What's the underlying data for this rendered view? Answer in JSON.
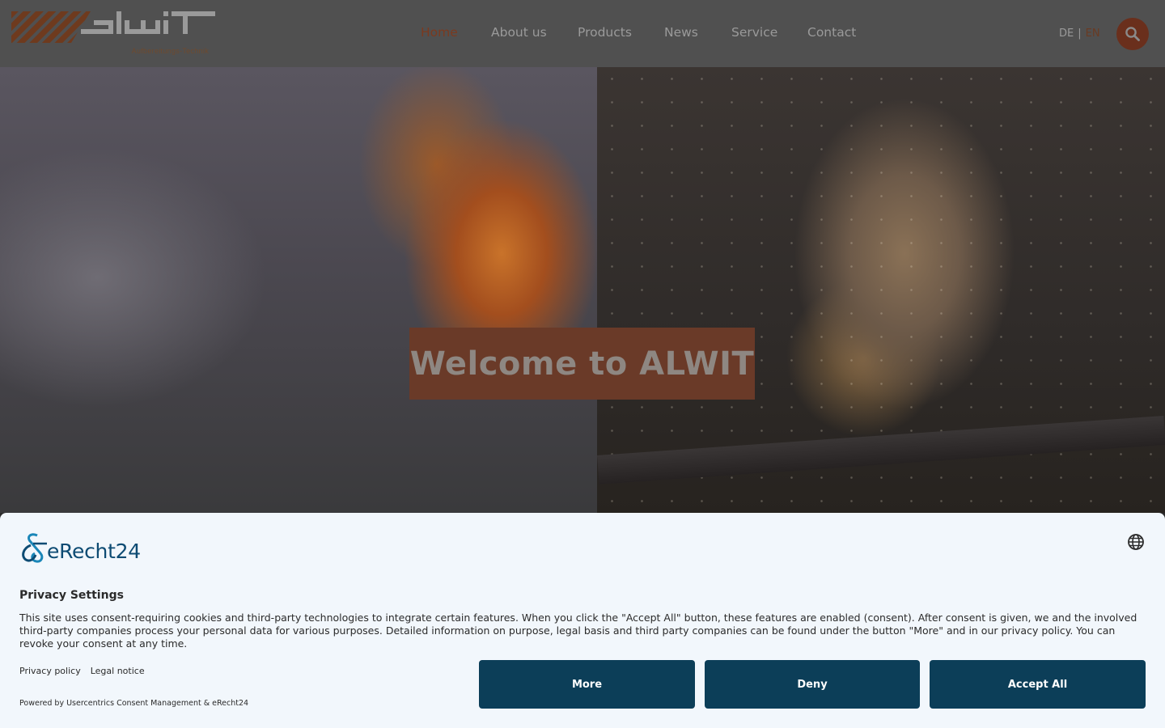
{
  "header": {
    "logo_text": "alwit",
    "tagline": "Aufbereitungs-Technik",
    "nav": [
      {
        "label": "Home",
        "active": true
      },
      {
        "label": "About us",
        "active": false
      },
      {
        "label": "Products",
        "active": false
      },
      {
        "label": "News",
        "active": false
      },
      {
        "label": "Service",
        "active": false
      },
      {
        "label": "Contact",
        "active": false
      }
    ],
    "languages": {
      "de": "DE",
      "separator": "|",
      "en": "EN",
      "active": "EN"
    },
    "search_icon": "search-icon"
  },
  "hero": {
    "title": "Welcome to ALWIT"
  },
  "consent": {
    "brand": "eRecht24",
    "globe_icon": "globe-icon",
    "title": "Privacy Settings",
    "text": "This site uses consent-requiring cookies and third-party technologies to integrate certain features. When you click the \"Accept All\" button, these features are enabled (consent). After consent is given, we and the involved third-party companies process your personal data for various purposes. Detailed information on purpose, legal basis and third party companies can be found under the button \"More\" and in our privacy policy. You can revoke your consent at any time.",
    "links": {
      "privacy": "Privacy policy",
      "legal": "Legal notice"
    },
    "powered_by": "Powered by Usercentrics Consent Management & eRecht24",
    "buttons": {
      "more": "More",
      "deny": "Deny",
      "accept": "Accept All"
    }
  },
  "colors": {
    "brand_orange": "#c05a26",
    "button_navy": "#0c3e58",
    "header_bg": "#505050",
    "banner_bg": "#f2f7fc"
  }
}
